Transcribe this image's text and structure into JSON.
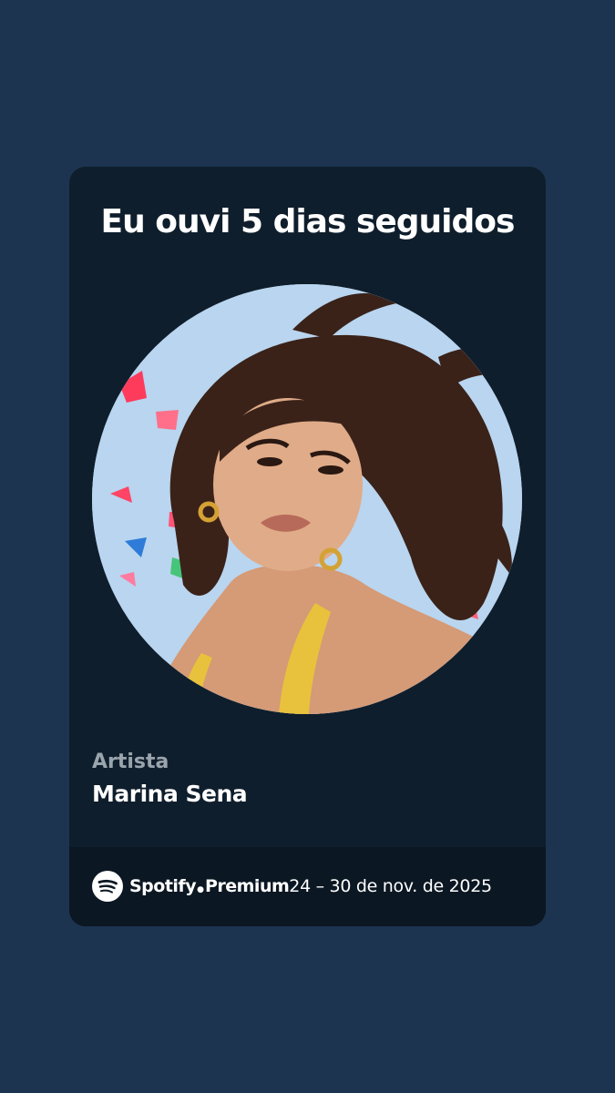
{
  "headline": "Eu ouvi 5 dias seguidos",
  "artist": {
    "label": "Artista",
    "name": "Marina Sena"
  },
  "footer": {
    "brand": "Spotify",
    "tier": "Premium",
    "period": "24 – 30 de nov. de 2025"
  },
  "icons": {
    "brand_logo": "spotify-logo-icon"
  },
  "colors": {
    "background": "#1c3450",
    "card": "#0f1e2c",
    "footer": "#0b1722",
    "text_primary": "#ffffff",
    "text_secondary": "#9aa4ad"
  }
}
